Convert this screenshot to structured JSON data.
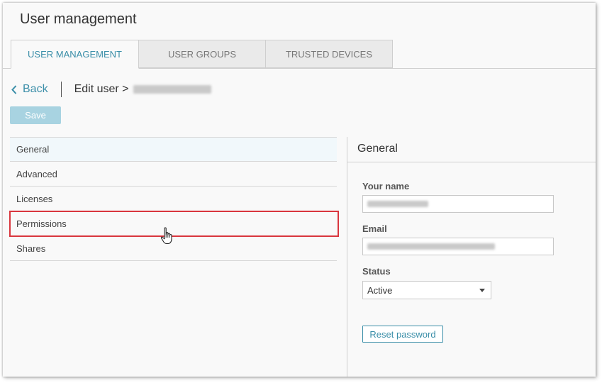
{
  "app": {
    "title": "User management"
  },
  "tabs": [
    {
      "label": "USER MANAGEMENT",
      "active": true
    },
    {
      "label": "USER GROUPS",
      "active": false
    },
    {
      "label": "TRUSTED DEVICES",
      "active": false
    }
  ],
  "breadcrumb": {
    "back_label": "Back",
    "edit_label": "Edit user >"
  },
  "toolbar": {
    "save_label": "Save"
  },
  "nav": {
    "items": [
      {
        "label": "General"
      },
      {
        "label": "Advanced"
      },
      {
        "label": "Licenses"
      },
      {
        "label": "Permissions"
      },
      {
        "label": "Shares"
      }
    ]
  },
  "panel": {
    "title": "General",
    "name_label": "Your name",
    "email_label": "Email",
    "status_label": "Status",
    "status_value": "Active",
    "reset_label": "Reset password"
  },
  "colors": {
    "accent": "#3a8ea8",
    "save_button": "#a8d3e1",
    "highlight_box": "#d9363e",
    "active_nav_bg": "#f1f8fb"
  },
  "icons": {
    "back": "chevron-left-icon",
    "cursor": "hand-pointer-icon",
    "select": "caret-down-icon"
  }
}
